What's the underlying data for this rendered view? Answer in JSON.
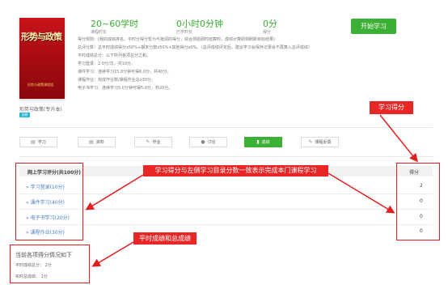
{
  "course": {
    "cover_title": "形势与政策",
    "cover_sub": "形势与政策课程组",
    "name": "形势与政策(专升本)",
    "badge": "选修"
  },
  "stats": [
    {
      "value": "20~60学时",
      "label": "课程时长"
    },
    {
      "value": "0小时0分钟",
      "label": "已学时长"
    },
    {
      "value": "0分",
      "label": "得分"
    }
  ],
  "info_lines": [
    "得分规则：(我的成绩排名，平时分得分暂为与批阅的得分，综合测验即时结算时，成绩计算即刻刷新目标结果)",
    "总评分数：总平时成绩得分x50%+期末分数x50%+其他得分x0%。（总评成绩评定后，建议学习会保存记录会不再算入总评成绩）",
    "平时成绩总分：以下所列各项总分之和。",
    "学习登录：2.0分/次，共10分。",
    "课件学习：连续学习15.0分钟可得6.0分，共40分。",
    "课程作业：完成作业数/课程作业总x30分。",
    "电子书学习：连续学习5.0分钟可得5.0分，共20分。"
  ],
  "start_button": "开始学习",
  "tabs": [
    {
      "icon": "▤",
      "label": "学习"
    },
    {
      "icon": "▤",
      "label": "资料"
    },
    {
      "icon": "✎",
      "label": "作业"
    },
    {
      "icon": "●",
      "label": "讨论"
    },
    {
      "icon": "▮",
      "label": "成绩"
    },
    {
      "icon": "✎",
      "label": "课程反馈"
    }
  ],
  "table": {
    "header_left": "网上学习评分(共100分)",
    "header_right": "得分",
    "rows": [
      {
        "label": "学习登录(10分)",
        "score": "2"
      },
      {
        "label": "课件学习(40分)",
        "score": "0"
      },
      {
        "label": "电子书学习(20分)",
        "score": "0"
      },
      {
        "label": "课程作业(30分)",
        "score": "0"
      }
    ]
  },
  "annotations": {
    "study_score": "学习得分",
    "consistency": "学习得分与左侧学习目录分数一致表示完成本门课程学习",
    "grade_summary": "平时成绩和总成绩"
  },
  "summary": {
    "title": "当前各项得分情况如下",
    "usual": "平时成绩总分： 2分",
    "total": "实时总成绩： 1分"
  },
  "colors": {
    "accent_green": "#3cb034",
    "annotation_red": "#e82626",
    "link_blue": "#4a7fc0",
    "cover_red": "#c8141a"
  }
}
